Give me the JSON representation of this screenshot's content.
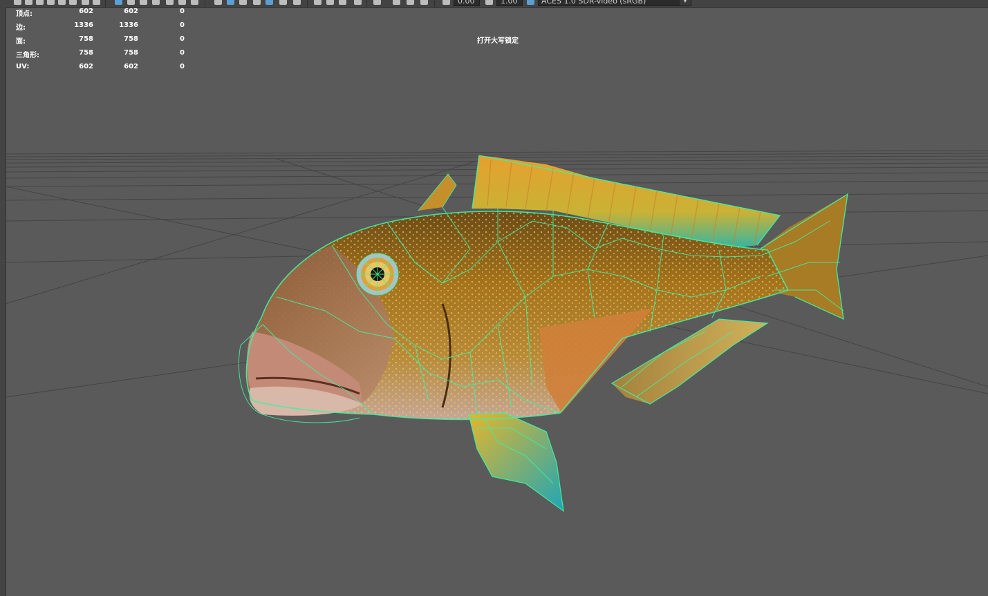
{
  "toolbar": {
    "exposure_value": "0.00",
    "gamma_value": "1.00",
    "color_space": "ACES 1.0 SDR-video (sRGB)",
    "icons": [
      "camera-icon",
      "grid-icon",
      "film-icon",
      "bookmark-icon",
      "select-camera-icon",
      "lock-icon",
      "wireframe-icon",
      "smooth-shade-icon",
      "textured-icon",
      "lights-icon",
      "shadows-icon",
      "ambient-occlusion-icon",
      "motion-blur-icon",
      "aa-icon",
      "isolate-icon",
      "xray-icon",
      "resolution-gate-icon",
      "film-gate-icon",
      "field-chart-icon",
      "safe-action-icon",
      "safe-title-icon",
      "snapshot-icon",
      "exposure-icon",
      "gamma-icon",
      "color-management-icon"
    ]
  },
  "hud": {
    "rows": [
      {
        "label": "顶点:",
        "v1": "602",
        "v2": "602",
        "v3": "0"
      },
      {
        "label": "边:",
        "v1": "1336",
        "v2": "1336",
        "v3": "0"
      },
      {
        "label": "面:",
        "v1": "758",
        "v2": "758",
        "v3": "0"
      },
      {
        "label": "三角形:",
        "v1": "758",
        "v2": "758",
        "v3": "0"
      },
      {
        "label": "UV:",
        "v1": "602",
        "v2": "602",
        "v3": "0"
      }
    ],
    "message": "打开大写锁定"
  },
  "scene": {
    "wireframe_color": "#3df2a2",
    "background_color": "#5a5a5a",
    "grid_color": "#3f3f3f"
  }
}
